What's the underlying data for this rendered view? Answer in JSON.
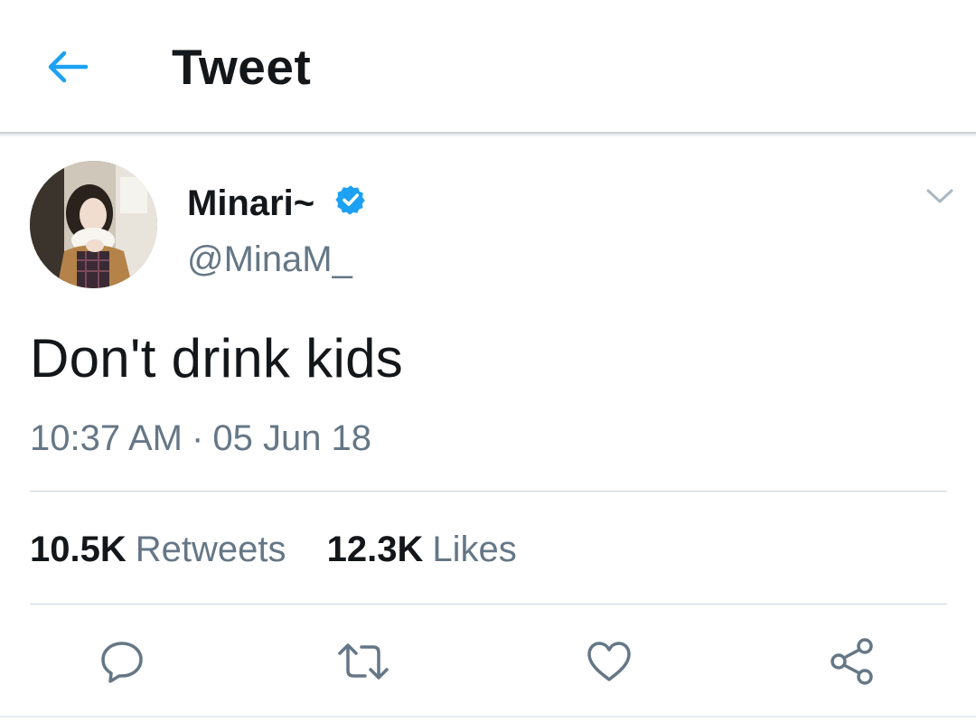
{
  "header": {
    "title": "Tweet",
    "back_icon": "arrow-left-icon",
    "accent_color": "#1da1f2"
  },
  "tweet": {
    "author": {
      "name": "Minari~",
      "handle": "@MinaM_",
      "verified": true,
      "verified_icon": "verified-badge-icon"
    },
    "text": "Don't drink kids",
    "time": "10:37 AM",
    "separator": "·",
    "date": "05 Jun 18",
    "stats": {
      "retweets_count": "10.5K",
      "retweets_label": "Retweets",
      "likes_count": "12.3K",
      "likes_label": "Likes"
    },
    "actions": [
      {
        "name": "reply",
        "icon": "reply-bubble-icon"
      },
      {
        "name": "retweet",
        "icon": "retweet-icon"
      },
      {
        "name": "like",
        "icon": "heart-icon"
      },
      {
        "name": "share",
        "icon": "share-icon"
      }
    ]
  },
  "colors": {
    "text_primary": "#14171a",
    "text_secondary": "#657786",
    "divider": "#ccd6dd",
    "verified": "#1da1f2"
  }
}
